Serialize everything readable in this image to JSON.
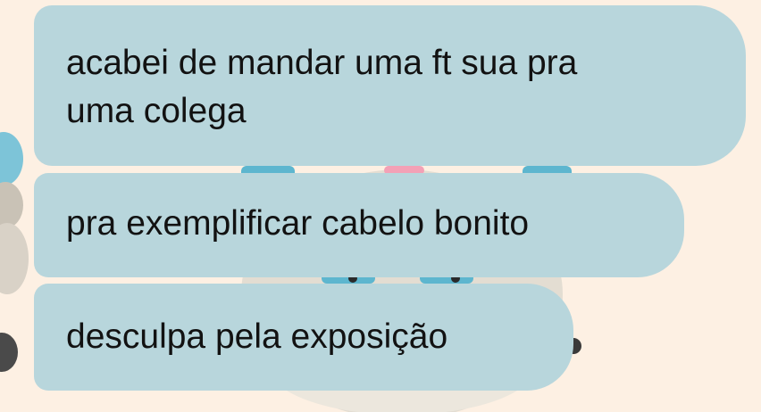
{
  "chat": {
    "messages": [
      {
        "text": "acabei de mandar uma ft sua pra uma colega",
        "lines": [
          "acabei de mandar uma ft sua pra",
          "uma colega"
        ]
      },
      {
        "text": "pra exemplificar cabelo bonito"
      },
      {
        "text": "desculpa pela exposição"
      }
    ]
  },
  "colors": {
    "background": "#fdf0e3",
    "bubble": "#b8d6dc",
    "text": "#121212"
  }
}
